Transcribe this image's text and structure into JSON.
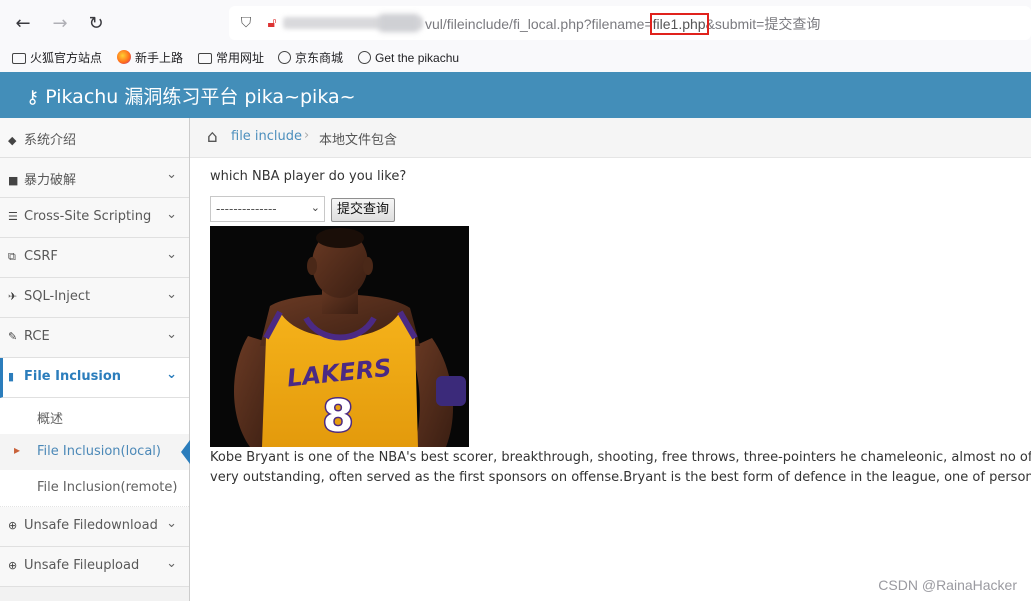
{
  "browser": {
    "url_visible": "vul/fileinclude/fi_local.php?filename=",
    "url_highlight": "file1.php",
    "url_rest": "&submit=提交查询",
    "bookmarks": [
      "火狐官方站点",
      "新手上路",
      "常用网址",
      "京东商城",
      "Get the pikachu"
    ],
    "highlight_color": "#e0221c"
  },
  "app": {
    "title": "Pikachu 漏洞练习平台 pika~pika~",
    "header_color": "#438eb9"
  },
  "sidebar": {
    "items": [
      {
        "label": "系统介绍",
        "icon": "tags-icon"
      },
      {
        "label": "暴力破解",
        "icon": "lock-icon"
      },
      {
        "label": "Cross-Site Scripting",
        "icon": "list-icon"
      },
      {
        "label": "CSRF",
        "icon": "share-icon"
      },
      {
        "label": "SQL-Inject",
        "icon": "inject-icon"
      },
      {
        "label": "RCE",
        "icon": "pencil-icon"
      },
      {
        "label": "File Inclusion",
        "icon": "file-icon"
      },
      {
        "label": "Unsafe Filedownload",
        "icon": "download-icon"
      },
      {
        "label": "Unsafe Fileupload",
        "icon": "upload-icon"
      }
    ],
    "subitems": [
      "概述",
      "File Inclusion(local)",
      "File Inclusion(remote)"
    ],
    "accent_color": "#2b7dbc"
  },
  "breadcrumb": {
    "crumb1": "file include",
    "crumb2": "本地文件包含"
  },
  "content": {
    "question": "which NBA player do you like?",
    "select_value": "--------------",
    "submit_label": "提交查询",
    "desc_line1": "Kobe Bryant is one of the NBA's best scorer, breakthrough, shooting, free throws, three-pointers he chameleonic, almost no offensive bli",
    "desc_line2": "very outstanding, often served as the first sponsors on offense.Bryant is the best form of defence in the league, one of personal defense",
    "jersey_text": "LAKERS",
    "jersey_number": "8"
  },
  "watermark": "CSDN @RainaHacker"
}
